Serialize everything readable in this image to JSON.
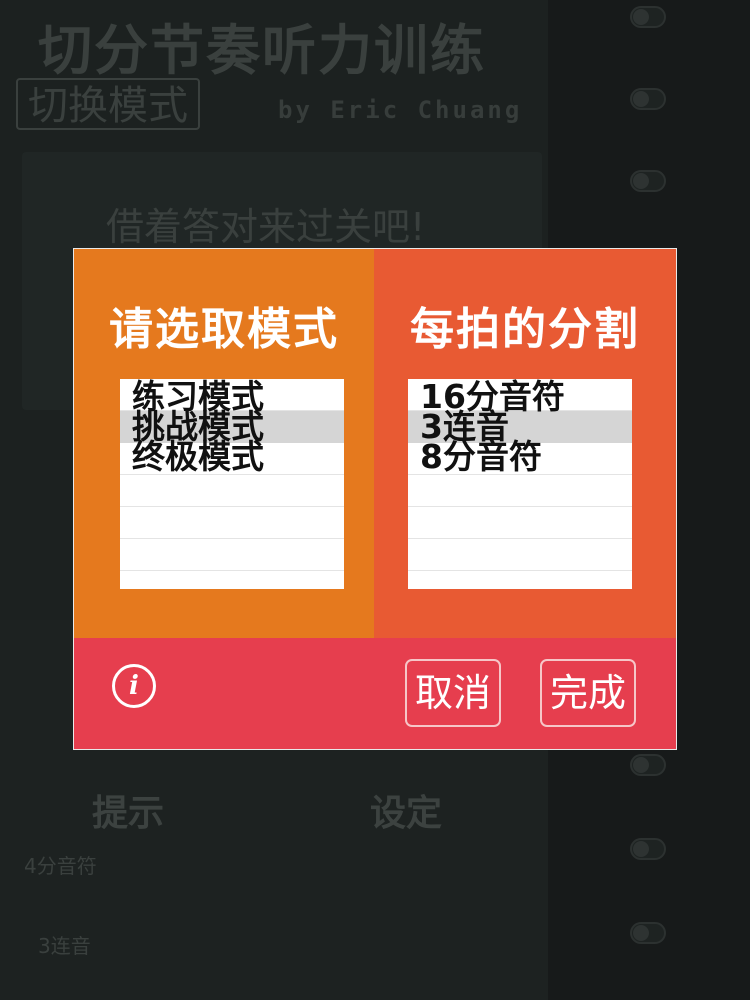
{
  "background": {
    "title": "切分节奏听力训练",
    "switch_mode_label": "切换模式",
    "author": "by Eric Chuang",
    "panel_text": "借着答对来过关吧!",
    "hint_label": "提示",
    "setting_label": "设定",
    "items": [
      "4分音符",
      "3连音"
    ]
  },
  "modal": {
    "mode_column": {
      "title": "请选取模式",
      "options": [
        "练习模式",
        "挑战模式",
        "终极模式"
      ],
      "selected": "挑战模式"
    },
    "division_column": {
      "title": "每拍的分割",
      "options": [
        "16分音符",
        "3连音",
        "8分音符"
      ],
      "selected": "3连音"
    },
    "footer": {
      "info_icon": "info-icon",
      "cancel_label": "取消",
      "done_label": "完成"
    }
  },
  "colors": {
    "left_column": "#e5791e",
    "right_column": "#e85a33",
    "footer": "#e63e4e"
  }
}
